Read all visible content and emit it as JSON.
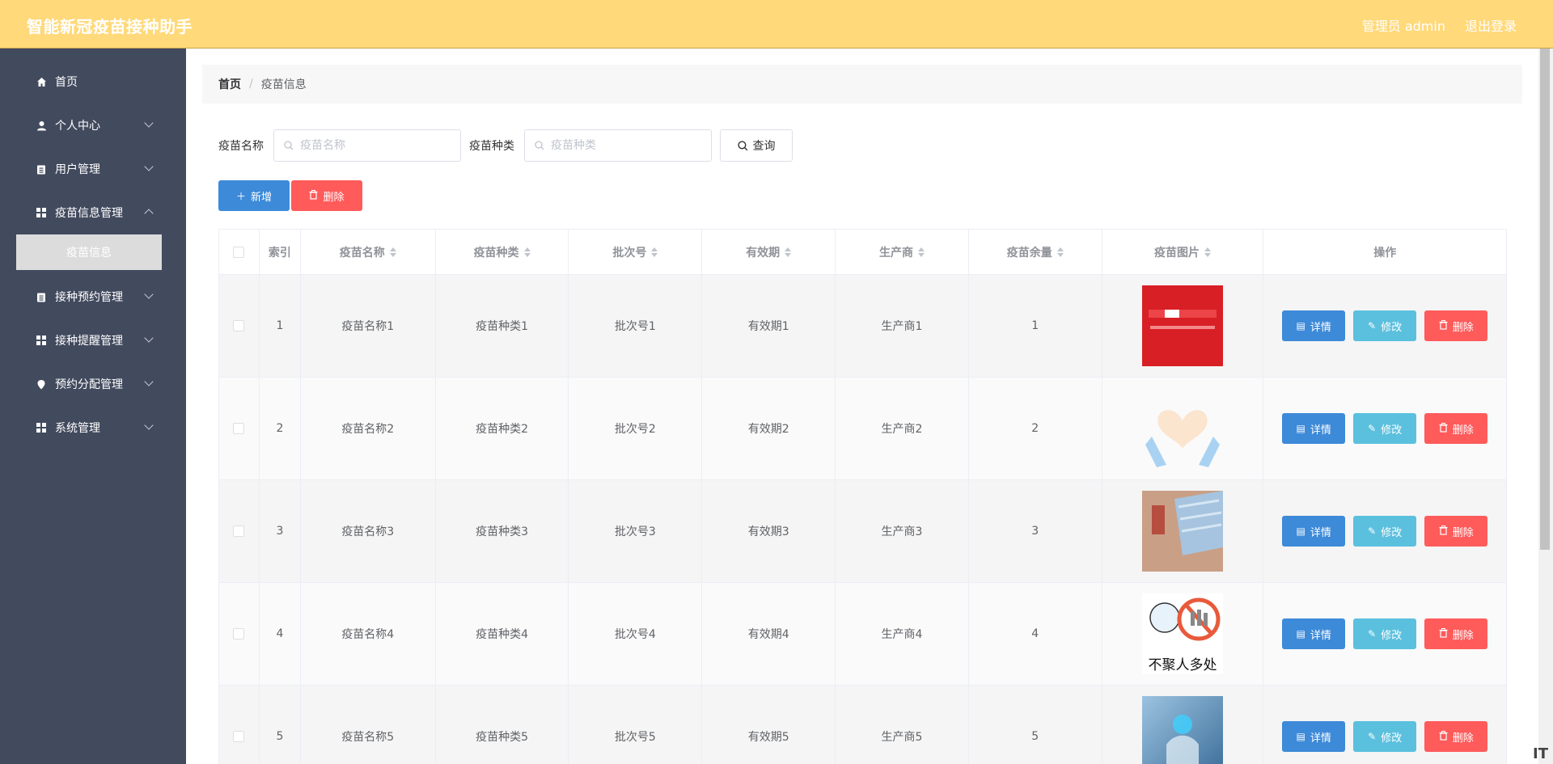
{
  "header": {
    "title": "智能新冠疫苗接种助手",
    "user": "管理员 admin",
    "logout": "退出登录"
  },
  "sidebar": {
    "items": [
      {
        "label": "首页",
        "icon": "home-icon"
      },
      {
        "label": "个人中心",
        "icon": "user-icon"
      },
      {
        "label": "用户管理",
        "icon": "clipboard-icon"
      },
      {
        "label": "疫苗信息管理",
        "icon": "grid-icon"
      },
      {
        "label": "接种预约管理",
        "icon": "clipboard-icon"
      },
      {
        "label": "接种提醒管理",
        "icon": "grid-icon"
      },
      {
        "label": "预约分配管理",
        "icon": "location-icon"
      },
      {
        "label": "系统管理",
        "icon": "grid-icon"
      }
    ],
    "active_sub": "疫苗信息"
  },
  "breadcrumb": {
    "home": "首页",
    "sep": "/",
    "current": "疫苗信息"
  },
  "search": {
    "name_label": "疫苗名称",
    "name_placeholder": "疫苗名称",
    "type_label": "疫苗种类",
    "type_placeholder": "疫苗种类",
    "query_label": "查询"
  },
  "actions": {
    "add_label": "新增",
    "delete_label": "删除"
  },
  "table": {
    "headers": [
      "索引",
      "疫苗名称",
      "疫苗种类",
      "批次号",
      "有效期",
      "生产商",
      "疫苗余量",
      "疫苗图片",
      "操作"
    ],
    "rows": [
      {
        "index": "1",
        "name": "疫苗名称1",
        "type": "疫苗种类1",
        "batch": "批次号1",
        "expiry": "有效期1",
        "maker": "生产商1",
        "stock": "1"
      },
      {
        "index": "2",
        "name": "疫苗名称2",
        "type": "疫苗种类2",
        "batch": "批次号2",
        "expiry": "有效期2",
        "maker": "生产商2",
        "stock": "2"
      },
      {
        "index": "3",
        "name": "疫苗名称3",
        "type": "疫苗种类3",
        "batch": "批次号3",
        "expiry": "有效期3",
        "maker": "生产商3",
        "stock": "3"
      },
      {
        "index": "4",
        "name": "疫苗名称4",
        "type": "疫苗种类4",
        "batch": "批次号4",
        "expiry": "有效期4",
        "maker": "生产商4",
        "stock": "4"
      },
      {
        "index": "5",
        "name": "疫苗名称5",
        "type": "疫苗种类5",
        "batch": "批次号5",
        "expiry": "有效期5",
        "maker": "生产商5",
        "stock": "5"
      }
    ],
    "row_actions": {
      "detail": "详情",
      "edit": "修改",
      "delete": "删除"
    }
  },
  "images": {
    "img4_text": "不聚人多处"
  },
  "watermark": "IT"
}
